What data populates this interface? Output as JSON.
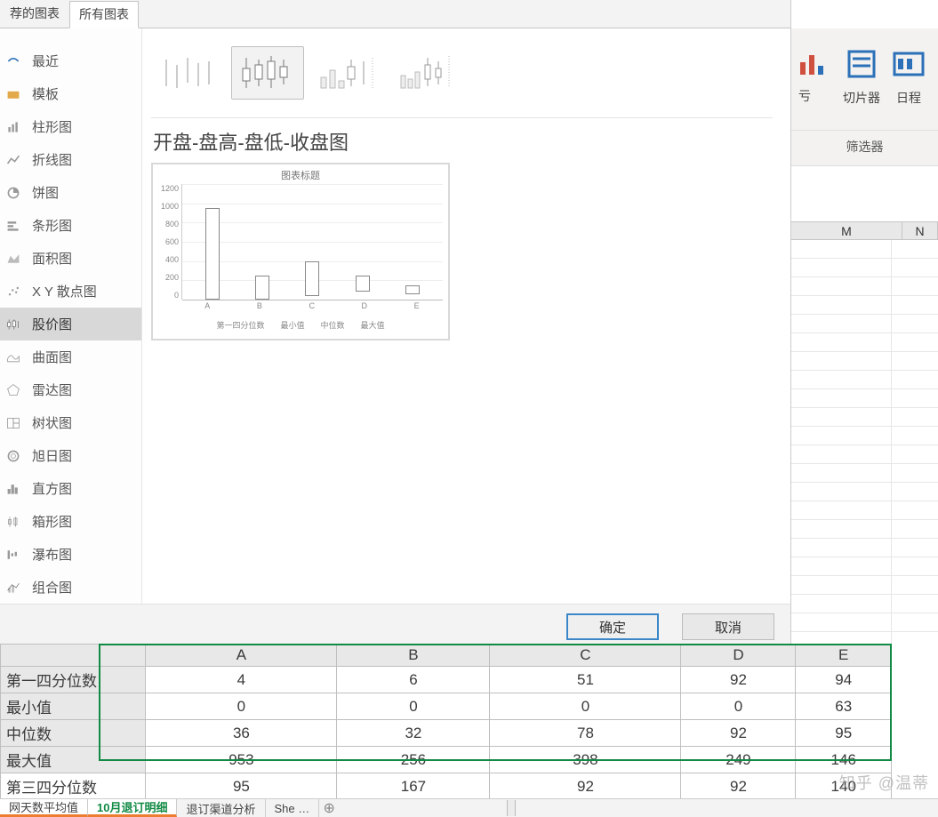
{
  "dialog": {
    "tabs": {
      "recommended": "荐的图表",
      "all": "所有图表"
    },
    "sidebar": [
      {
        "key": "recent",
        "label": "最近"
      },
      {
        "key": "template",
        "label": "模板"
      },
      {
        "key": "column",
        "label": "柱形图"
      },
      {
        "key": "line",
        "label": "折线图"
      },
      {
        "key": "pie",
        "label": "饼图"
      },
      {
        "key": "bar",
        "label": "条形图"
      },
      {
        "key": "area",
        "label": "面积图"
      },
      {
        "key": "scatter",
        "label": "X Y 散点图"
      },
      {
        "key": "stock",
        "label": "股价图"
      },
      {
        "key": "surface",
        "label": "曲面图"
      },
      {
        "key": "radar",
        "label": "雷达图"
      },
      {
        "key": "treemap",
        "label": "树状图"
      },
      {
        "key": "sunburst",
        "label": "旭日图"
      },
      {
        "key": "histogram",
        "label": "直方图"
      },
      {
        "key": "box",
        "label": "箱形图"
      },
      {
        "key": "waterfall",
        "label": "瀑布图"
      },
      {
        "key": "combo",
        "label": "组合图"
      }
    ],
    "chart_subtype_title": "开盘-盘高-盘低-收盘图",
    "preview": {
      "title": "图表标题",
      "y_ticks": [
        "1200",
        "1000",
        "800",
        "600",
        "400",
        "200",
        "0"
      ],
      "x_labels": [
        "A",
        "B",
        "C",
        "D",
        "E"
      ],
      "legend": [
        "第一四分位数",
        "最小值",
        "中位数",
        "最大值"
      ]
    },
    "buttons": {
      "ok": "确定",
      "cancel": "取消"
    }
  },
  "ribbon": {
    "gain_loss_partial": "亏",
    "slicer": "切片器",
    "timeline": "日程",
    "group_label": "筛选器"
  },
  "sheet_cols": {
    "m": "M",
    "n_partial": "N"
  },
  "table": {
    "headers": [
      "",
      "A",
      "B",
      "C",
      "D",
      "E"
    ],
    "rows": [
      {
        "label": "第一四分位数",
        "vals": [
          "4",
          "6",
          "51",
          "92",
          "94"
        ]
      },
      {
        "label": "最小值",
        "vals": [
          "0",
          "0",
          "0",
          "0",
          "63"
        ]
      },
      {
        "label": "中位数",
        "vals": [
          "36",
          "32",
          "78",
          "92",
          "95"
        ]
      },
      {
        "label": "最大值",
        "vals": [
          "953",
          "256",
          "398",
          "249",
          "146"
        ]
      },
      {
        "label": "第三四分位数",
        "vals": [
          "95",
          "167",
          "92",
          "92",
          "140"
        ]
      }
    ]
  },
  "sheet_tabs": {
    "t1": "网天数平均值",
    "t2": "10月退订明细",
    "t3": "退订渠道分析",
    "t4": "She …"
  },
  "watermark": "知乎 @温蒂",
  "chart_data": {
    "type": "bar",
    "title": "图表标题",
    "categories": [
      "A",
      "B",
      "C",
      "D",
      "E"
    ],
    "series": [
      {
        "name": "第一四分位数",
        "values": [
          4,
          6,
          51,
          92,
          94
        ]
      },
      {
        "name": "最小值",
        "values": [
          0,
          0,
          0,
          0,
          63
        ]
      },
      {
        "name": "中位数",
        "values": [
          36,
          32,
          78,
          92,
          95
        ]
      },
      {
        "name": "最大值",
        "values": [
          953,
          256,
          398,
          249,
          146
        ]
      }
    ],
    "ylim": [
      0,
      1200
    ],
    "ylabel": "",
    "xlabel": ""
  }
}
